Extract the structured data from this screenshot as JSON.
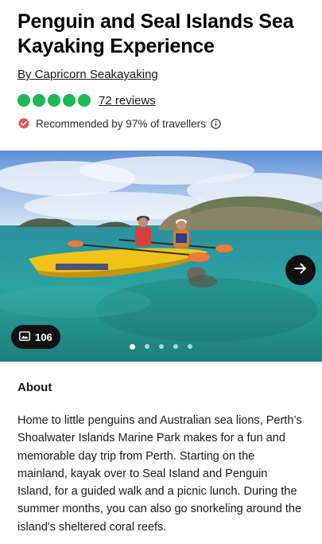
{
  "product": {
    "title": "Penguin and Seal Islands Sea Kayaking Experience",
    "byline": "By Capricorn Seakayaking",
    "rating": 5,
    "rating_max": 5,
    "rating_color": "#1db954",
    "reviews_label": "72 reviews",
    "recommended_text": "Recommended by 97% of travellers"
  },
  "gallery": {
    "photo_count": "106",
    "dots_total": 5,
    "active_dot": 0,
    "icons": [
      "photo-icon",
      "arrow-right-icon"
    ]
  },
  "about": {
    "heading": "About",
    "text": "Home to little penguins and Australian sea lions, Perth’s Shoalwater Islands Marine Park makes for a fun and memorable day trip from Perth. Starting on the mainland, kayak over to Seal Island and Penguin Island, for a guided walk and a picnic lunch. During the summer months, you can also go snorkeling around the island's sheltered coral reefs."
  }
}
